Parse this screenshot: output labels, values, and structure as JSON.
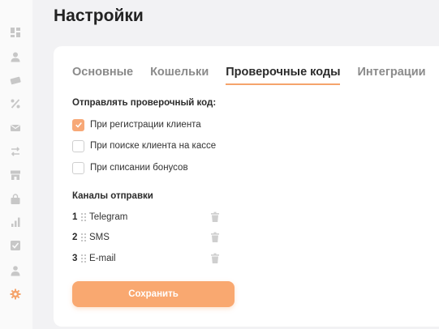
{
  "page": {
    "title": "Настройки"
  },
  "sidebar": {
    "icons": [
      "dashboard-icon",
      "user-icon",
      "card-icon",
      "percent-icon",
      "mail-icon",
      "transfer-icon",
      "store-icon",
      "shopping-bag-icon",
      "bar-chart-icon",
      "checklist-icon",
      "staff-icon",
      "gear-icon"
    ],
    "active_icon": "gear-icon",
    "colors": {
      "icon": "#c7c7c7",
      "active": "#f5a46c"
    }
  },
  "tabs": [
    {
      "label": "Основные",
      "active": false
    },
    {
      "label": "Кошельки",
      "active": false
    },
    {
      "label": "Проверочные коды",
      "active": true
    },
    {
      "label": "Интеграции",
      "active": false
    }
  ],
  "send_code": {
    "label": "Отправлять проверочный код:",
    "options": [
      {
        "label": "При регистрации клиента",
        "checked": true
      },
      {
        "label": "При поиске клиента на кассе",
        "checked": false
      },
      {
        "label": "При списании бонусов",
        "checked": false
      }
    ]
  },
  "channels": {
    "label": "Каналы отправки",
    "items": [
      {
        "num": "1",
        "name": "Telegram"
      },
      {
        "num": "2",
        "name": "SMS"
      },
      {
        "num": "3",
        "name": "E-mail"
      }
    ]
  },
  "save_button": {
    "label": "Сохранить"
  },
  "colors": {
    "accent": "#f5a46c",
    "button": "#f9a870",
    "background": "#f2f2f4"
  }
}
